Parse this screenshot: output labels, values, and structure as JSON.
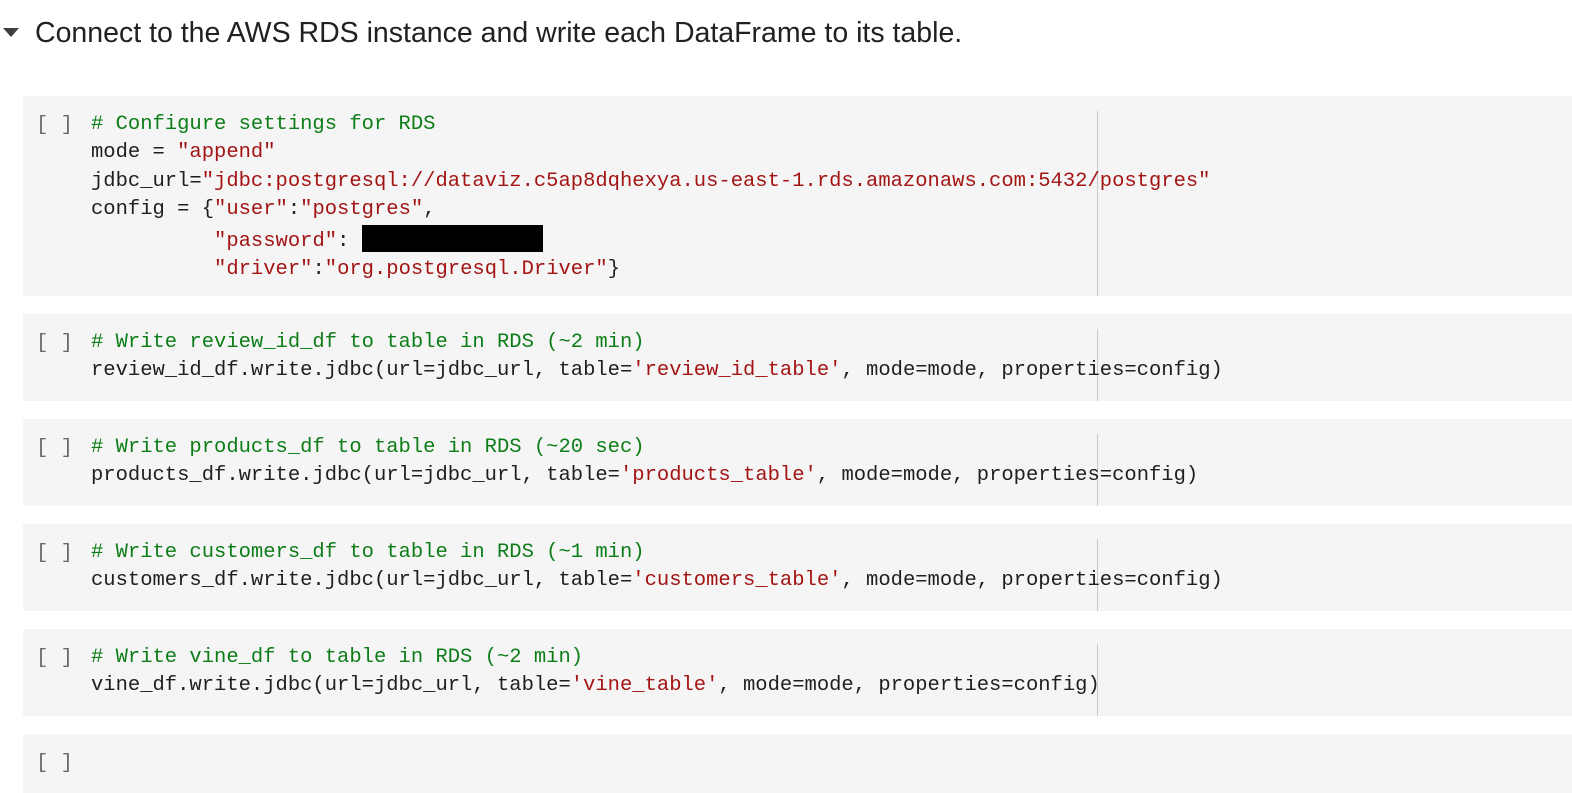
{
  "section": {
    "title": "Connect to the AWS RDS instance and write each DataFrame to its table."
  },
  "run_indicator": "[ ]",
  "cells": {
    "c1": {
      "comment": "# Configure settings for RDS",
      "l2_a": "mode = ",
      "l2_b": "\"append\"",
      "l3_a": "jdbc_url=",
      "l3_b": "\"jdbc:postgresql://dataviz.c5ap8dqhexya.us-east-1.rds.amazonaws.com:5432/postgres\"",
      "l4_a": "config = {",
      "l4_b": "\"user\"",
      "l4_c": ":",
      "l4_d": "\"postgres\"",
      "l4_e": ",",
      "l5_a": "          ",
      "l5_b": "\"password\"",
      "l5_c": ": ",
      "l6_a": "          ",
      "l6_b": "\"driver\"",
      "l6_c": ":",
      "l6_d": "\"org.postgresql.Driver\"",
      "l6_e": "}"
    },
    "c2": {
      "comment": "# Write review_id_df to table in RDS (~2 min)",
      "a": "review_id_df.write.jdbc(url=jdbc_url, table=",
      "b": "'review_id_table'",
      "c": ", mode=mode, properties=config)"
    },
    "c3": {
      "comment": "# Write products_df to table in RDS (~20 sec)",
      "a": "products_df.write.jdbc(url=jdbc_url, table=",
      "b": "'products_table'",
      "c": ", mode=mode, properties=config)"
    },
    "c4": {
      "comment": "# Write customers_df to table in RDS (~1 min)",
      "a": "customers_df.write.jdbc(url=jdbc_url, table=",
      "b": "'customers_table'",
      "c": ", mode=mode, properties=config)"
    },
    "c5": {
      "comment": "# Write vine_df to table in RDS (~2 min)",
      "a": "vine_df.write.jdbc(url=jdbc_url, table=",
      "b": "'vine_table'",
      "c": ", mode=mode, properties=config)"
    }
  },
  "colors": {
    "comment": "#0d7d18",
    "string": "#a31515",
    "cell_background": "#f5f5f5"
  },
  "icons": {
    "collapse": "caret-down-icon"
  }
}
